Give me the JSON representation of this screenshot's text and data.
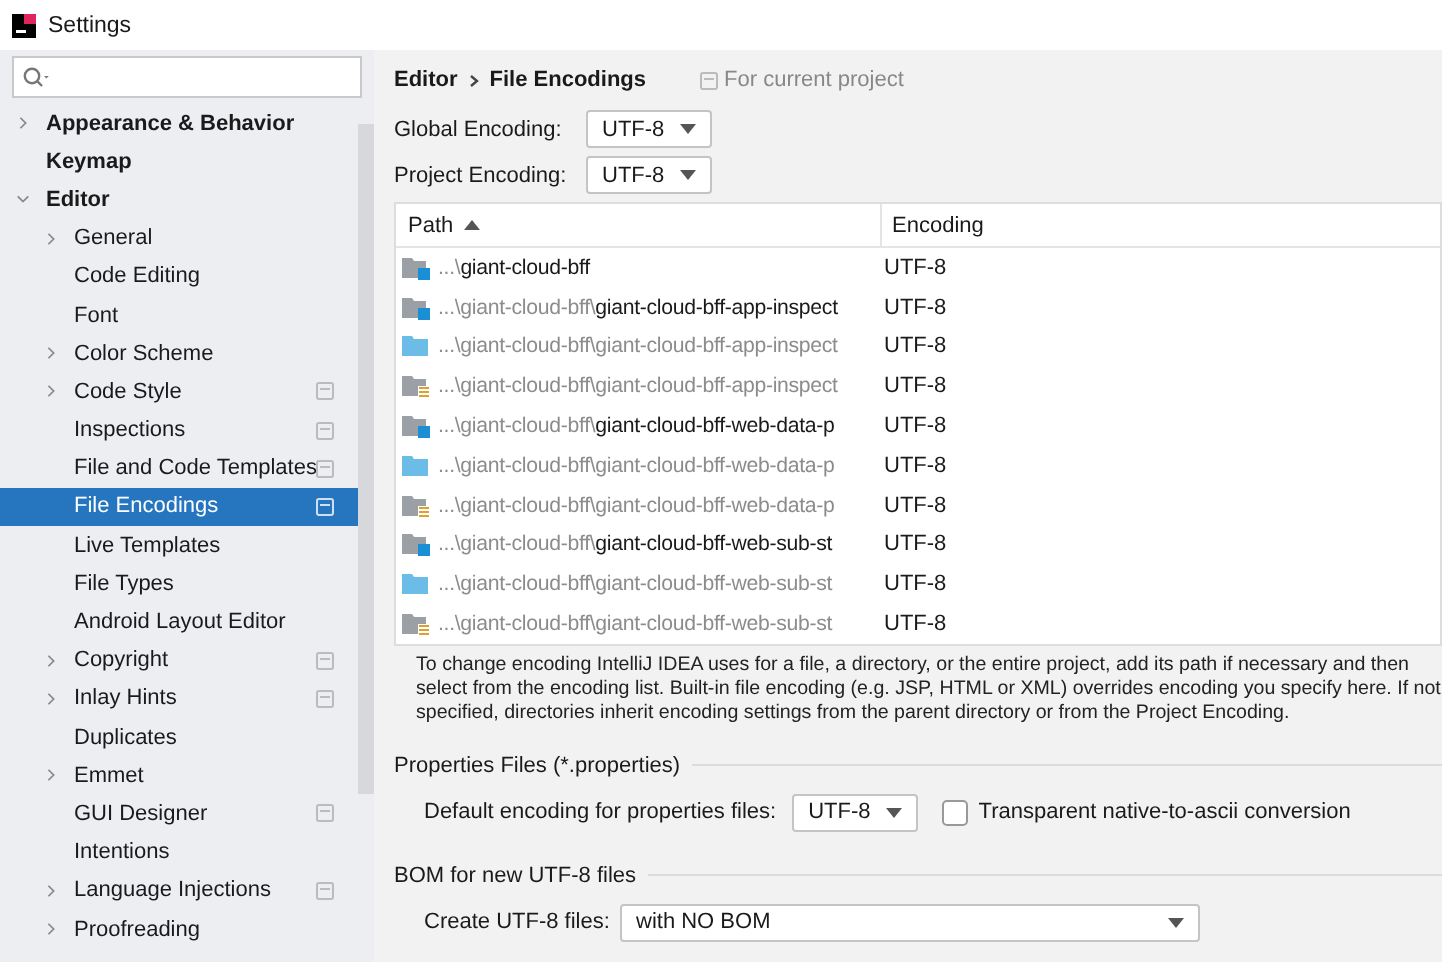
{
  "window": {
    "title": "Settings"
  },
  "sidebar": {
    "items": [
      {
        "label": "Appearance & Behavior",
        "selected": false,
        "expanded": false,
        "project_scope": false
      },
      {
        "label": "Keymap",
        "selected": false,
        "project_scope": false
      },
      {
        "label": "Editor",
        "selected": false,
        "expanded": true,
        "project_scope": false,
        "children": [
          {
            "label": "General",
            "selected": false,
            "expanded": false,
            "project_scope": false
          },
          {
            "label": "Code Editing",
            "selected": false,
            "project_scope": false
          },
          {
            "label": "Font",
            "selected": false,
            "project_scope": false
          },
          {
            "label": "Color Scheme",
            "selected": false,
            "expanded": false,
            "project_scope": false
          },
          {
            "label": "Code Style",
            "selected": false,
            "expanded": false,
            "project_scope": true
          },
          {
            "label": "Inspections",
            "selected": false,
            "project_scope": true
          },
          {
            "label": "File and Code Templates",
            "selected": false,
            "project_scope": true
          },
          {
            "label": "File Encodings",
            "selected": true,
            "project_scope": true
          },
          {
            "label": "Live Templates",
            "selected": false,
            "project_scope": false
          },
          {
            "label": "File Types",
            "selected": false,
            "project_scope": false
          },
          {
            "label": "Android Layout Editor",
            "selected": false,
            "project_scope": false
          },
          {
            "label": "Copyright",
            "selected": false,
            "expanded": false,
            "project_scope": true
          },
          {
            "label": "Inlay Hints",
            "selected": false,
            "expanded": false,
            "project_scope": true
          },
          {
            "label": "Duplicates",
            "selected": false,
            "project_scope": false
          },
          {
            "label": "Emmet",
            "selected": false,
            "expanded": false,
            "project_scope": false
          },
          {
            "label": "GUI Designer",
            "selected": false,
            "project_scope": true
          },
          {
            "label": "Intentions",
            "selected": false,
            "project_scope": false
          },
          {
            "label": "Language Injections",
            "selected": false,
            "expanded": false,
            "project_scope": true
          },
          {
            "label": "Proofreading",
            "selected": false,
            "expanded": false,
            "project_scope": false
          }
        ]
      }
    ]
  },
  "breadcrumb": {
    "parent": "Editor",
    "current": "File Encodings",
    "scope_note": "For current project"
  },
  "global_encoding": {
    "label": "Global Encoding:",
    "value": "UTF-8"
  },
  "project_encoding": {
    "label": "Project Encoding:",
    "value": "UTF-8"
  },
  "table": {
    "columns": [
      {
        "label": "Path",
        "sorted": true
      },
      {
        "label": "Encoding",
        "sorted": false
      }
    ],
    "rows": [
      {
        "kind": "module",
        "path_parts": [
          {
            "text": "...\\",
            "dim": true
          },
          {
            "text": "giant-cloud-bff",
            "dim": false
          }
        ],
        "encoding": "UTF-8"
      },
      {
        "kind": "module",
        "path_parts": [
          {
            "text": "...\\giant-cloud-bff\\",
            "dim": true
          },
          {
            "text": "giant-cloud-bff-app-inspect",
            "dim": false
          }
        ],
        "encoding": "UTF-8"
      },
      {
        "kind": "folder",
        "path_parts": [
          {
            "text": "...\\giant-cloud-bff\\giant-cloud-bff-app-inspect",
            "dim": true
          }
        ],
        "encoding": "UTF-8"
      },
      {
        "kind": "resources",
        "path_parts": [
          {
            "text": "...\\giant-cloud-bff\\giant-cloud-bff-app-inspect",
            "dim": true
          }
        ],
        "encoding": "UTF-8"
      },
      {
        "kind": "module",
        "path_parts": [
          {
            "text": "...\\giant-cloud-bff\\",
            "dim": true
          },
          {
            "text": "giant-cloud-bff-web-data-p",
            "dim": false
          }
        ],
        "encoding": "UTF-8"
      },
      {
        "kind": "folder",
        "path_parts": [
          {
            "text": "...\\giant-cloud-bff\\giant-cloud-bff-web-data-p",
            "dim": true
          }
        ],
        "encoding": "UTF-8"
      },
      {
        "kind": "resources",
        "path_parts": [
          {
            "text": "...\\giant-cloud-bff\\giant-cloud-bff-web-data-p",
            "dim": true
          }
        ],
        "encoding": "UTF-8"
      },
      {
        "kind": "module",
        "path_parts": [
          {
            "text": "...\\giant-cloud-bff\\",
            "dim": true
          },
          {
            "text": "giant-cloud-bff-web-sub-st",
            "dim": false
          }
        ],
        "encoding": "UTF-8"
      },
      {
        "kind": "folder",
        "path_parts": [
          {
            "text": "...\\giant-cloud-bff\\giant-cloud-bff-web-sub-st",
            "dim": true
          }
        ],
        "encoding": "UTF-8"
      },
      {
        "kind": "resources",
        "path_parts": [
          {
            "text": "...\\giant-cloud-bff\\giant-cloud-bff-web-sub-st",
            "dim": true
          }
        ],
        "encoding": "UTF-8"
      }
    ]
  },
  "description": "To change encoding IntelliJ IDEA uses for a file, a directory, or the entire project, add its path if necessary and then select from the encoding list. Built-in file encoding (e.g. JSP, HTML or XML) overrides encoding you specify here. If not specified, directories inherit encoding settings from the parent directory or from the Project Encoding.",
  "properties_section": {
    "title": "Properties Files (*.properties)",
    "default_label": "Default encoding for properties files:",
    "default_value": "UTF-8",
    "transparent": {
      "label": "Transparent native-to-ascii conversion",
      "checked": false
    }
  },
  "bom_section": {
    "title": "BOM for new UTF-8 files",
    "create_label": "Create UTF-8 files:",
    "create_value": "with NO BOM"
  }
}
